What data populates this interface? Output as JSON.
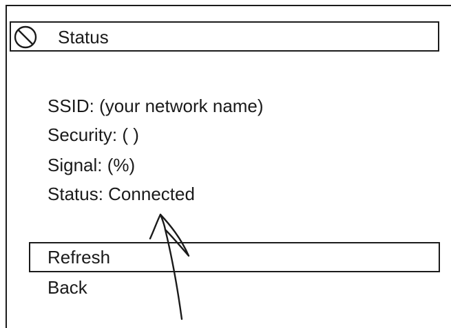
{
  "screen": {
    "title": "Status",
    "title_icon": "no-signal-icon"
  },
  "info": {
    "ssid": "SSID: (your network name)",
    "security": "Security: (   )",
    "signal": "Signal: (%)",
    "status": "Status: Connected"
  },
  "menu": {
    "items": [
      {
        "label": "Refresh",
        "selected": true
      },
      {
        "label": "Back",
        "selected": false
      }
    ]
  },
  "annotation": {
    "icon": "pointer-arrow-icon"
  }
}
